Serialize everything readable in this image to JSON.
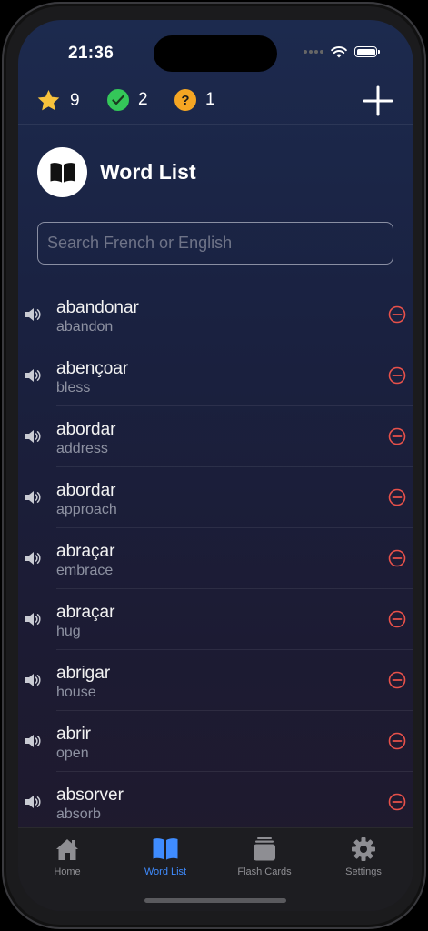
{
  "status": {
    "time": "21:36"
  },
  "stats": {
    "stars": "9",
    "correct": "2",
    "unknown": "1"
  },
  "header": {
    "title": "Word List"
  },
  "search": {
    "placeholder": "Search French or English"
  },
  "words": [
    {
      "fr": "abandonar",
      "en": "abandon"
    },
    {
      "fr": "abençoar",
      "en": "bless"
    },
    {
      "fr": "abordar",
      "en": "address"
    },
    {
      "fr": "abordar",
      "en": "approach"
    },
    {
      "fr": "abraçar",
      "en": "embrace"
    },
    {
      "fr": "abraçar",
      "en": "hug"
    },
    {
      "fr": "abrigar",
      "en": "house"
    },
    {
      "fr": "abrir",
      "en": "open"
    },
    {
      "fr": "absorver",
      "en": "absorb"
    }
  ],
  "tabs": [
    {
      "label": "Home",
      "icon": "house-icon"
    },
    {
      "label": "Word List",
      "icon": "book-icon",
      "active": true
    },
    {
      "label": "Flash Cards",
      "icon": "cards-icon"
    },
    {
      "label": "Settings",
      "icon": "gear-icon"
    }
  ],
  "colors": {
    "accent": "#3f8cff",
    "star": "#f7c23c",
    "check": "#34c759",
    "question": "#f5a623",
    "remove": "#e8514a"
  }
}
